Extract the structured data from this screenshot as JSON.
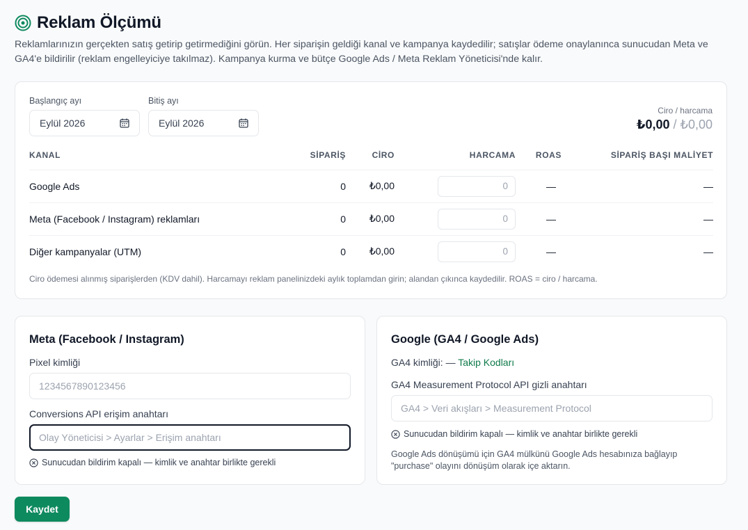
{
  "header": {
    "title": "Reklam Ölçümü",
    "description": "Reklamlarınızın gerçekten satış getirip getirmediğini görün. Her siparişin geldiği kanal ve kampanya kaydedilir; satışlar ödeme onaylanınca sunucudan Meta ve GA4'e bildirilir (reklam engelleyiciye takılmaz). Kampanya kurma ve bütçe Google Ads / Meta Reklam Yöneticisi'nde kalır."
  },
  "filters": {
    "start_label": "Başlangıç ayı",
    "start_value": "Eylül 2026",
    "end_label": "Bitiş ayı",
    "end_value": "Eylül 2026"
  },
  "summary": {
    "label": "Ciro / harcama",
    "ciro": "₺0,00",
    "separator": " / ",
    "harcama": "₺0,00"
  },
  "table": {
    "columns": [
      "KANAL",
      "SİPARİŞ",
      "CİRO",
      "HARCAMA",
      "ROAS",
      "SİPARİŞ BAŞI MALİYET"
    ],
    "rows": [
      {
        "channel": "Google Ads",
        "orders": "0",
        "revenue": "₺0,00",
        "spend_placeholder": "0",
        "roas": "—",
        "cpo": "—"
      },
      {
        "channel": "Meta (Facebook / Instagram) reklamları",
        "orders": "0",
        "revenue": "₺0,00",
        "spend_placeholder": "0",
        "roas": "—",
        "cpo": "—"
      },
      {
        "channel": "Diğer kampanyalar (UTM)",
        "orders": "0",
        "revenue": "₺0,00",
        "spend_placeholder": "0",
        "roas": "—",
        "cpo": "—"
      }
    ],
    "note": "Ciro ödemesi alınmış siparişlerden (KDV dahil). Harcamayı reklam panelinizdeki aylık toplamdan girin; alandan çıkınca kaydedilir. ROAS = ciro / harcama."
  },
  "meta": {
    "title": "Meta (Facebook / Instagram)",
    "pixel_label": "Pixel kimliği",
    "pixel_placeholder": "1234567890123456",
    "capi_label": "Conversions API erişim anahtarı",
    "capi_placeholder": "Olay Yöneticisi > Ayarlar > Erişim anahtarı",
    "status": "Sunucudan bildirim kapalı — kimlik ve anahtar birlikte gerekli"
  },
  "google": {
    "title": "Google (GA4 / Google Ads)",
    "ga4_id_label": "GA4 kimliği: — ",
    "ga4_link": "Takip Kodları",
    "secret_label": "GA4 Measurement Protocol API gizli anahtarı",
    "secret_placeholder": "GA4 > Veri akışları > Measurement Protocol",
    "status": "Sunucudan bildirim kapalı — kimlik ve anahtar birlikte gerekli",
    "note": "Google Ads dönüşümü için GA4 mülkünü Google Ads hesabınıza bağlayıp \"purchase\" olayını dönüşüm olarak içe aktarın."
  },
  "actions": {
    "save_label": "Kaydet"
  },
  "colors": {
    "accent": "#0e8a5f",
    "link": "#0f7a4a"
  },
  "icons": {
    "title": "target-icon",
    "date": "calendar-icon",
    "status": "x-circle-icon"
  }
}
